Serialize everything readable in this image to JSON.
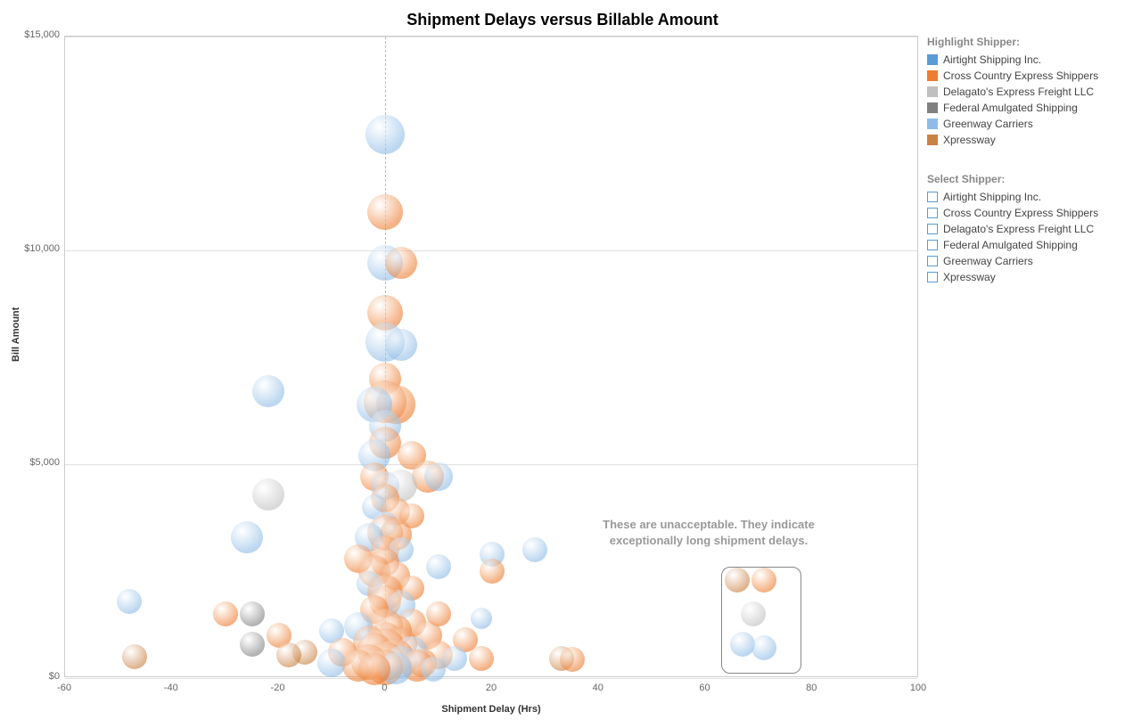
{
  "title": "Shipment Delays versus Billable Amount",
  "xlabel": "Shipment Delay (Hrs)",
  "ylabel": "Bill Amount",
  "xlim": [
    -60,
    100
  ],
  "ylim": [
    0,
    15000
  ],
  "x_ticks": [
    -60,
    -40,
    -20,
    0,
    20,
    40,
    60,
    80,
    100
  ],
  "y_ticks": [
    {
      "v": 0,
      "label": "$0"
    },
    {
      "v": 5000,
      "label": "$5,000"
    },
    {
      "v": 10000,
      "label": "$10,000"
    },
    {
      "v": 15000,
      "label": "$15,000"
    }
  ],
  "annotation": "These are unacceptable.  They indicate\nexceptionally long shipment delays.",
  "highlight_box": {
    "x0": 63,
    "x1": 78,
    "y0": 100,
    "y1": 2600
  },
  "legend_highlight_title": "Highlight Shipper:",
  "legend_select_title": "Select Shipper:",
  "shippers": [
    {
      "name": "Airtight Shipping Inc.",
      "color": "#5b9bd5"
    },
    {
      "name": "Cross Country Express Shippers",
      "color": "#ed7d31"
    },
    {
      "name": "Delagato's Express Freight LLC",
      "color": "#c0c0c0"
    },
    {
      "name": "Federal Amulgated Shipping",
      "color": "#808080"
    },
    {
      "name": "Greenway Carriers",
      "color": "#8fbce6"
    },
    {
      "name": "Xpressway",
      "color": "#c98244"
    }
  ],
  "chart_data": {
    "type": "scatter",
    "title": "Shipment Delays versus Billable Amount",
    "xlabel": "Shipment Delay (Hrs)",
    "ylabel": "Bill Amount",
    "xlim": [
      -60,
      100
    ],
    "ylim": [
      0,
      15000
    ],
    "reference_line_x": 0,
    "annotation": "These are unacceptable.  They indicate exceptionally long shipment delays.",
    "highlight_box": {
      "x_range": [
        63,
        78
      ],
      "y_range": [
        100,
        2600
      ]
    },
    "series": [
      {
        "name": "Airtight Shipping Inc.",
        "color": "#5b9bd5"
      },
      {
        "name": "Cross Country Express Shippers",
        "color": "#ed7d31"
      },
      {
        "name": "Delagato's Express Freight LLC",
        "color": "#c0c0c0"
      },
      {
        "name": "Federal Amulgated Shipping",
        "color": "#808080"
      },
      {
        "name": "Greenway Carriers",
        "color": "#8fbce6"
      },
      {
        "name": "Xpressway",
        "color": "#c98244"
      }
    ],
    "points": [
      {
        "x": 0,
        "y": 12700,
        "r": 22,
        "s": 4
      },
      {
        "x": 0,
        "y": 10900,
        "r": 20,
        "s": 1
      },
      {
        "x": 0,
        "y": 9700,
        "r": 20,
        "s": 4
      },
      {
        "x": 3,
        "y": 9700,
        "r": 18,
        "s": 1
      },
      {
        "x": 0,
        "y": 8550,
        "r": 20,
        "s": 1
      },
      {
        "x": 0,
        "y": 7850,
        "r": 22,
        "s": 4
      },
      {
        "x": 3,
        "y": 7800,
        "r": 18,
        "s": 4
      },
      {
        "x": 0,
        "y": 7000,
        "r": 18,
        "s": 1
      },
      {
        "x": -22,
        "y": 6700,
        "r": 18,
        "s": 4
      },
      {
        "x": 0,
        "y": 6450,
        "r": 24,
        "s": 1
      },
      {
        "x": 2,
        "y": 6400,
        "r": 22,
        "s": 1
      },
      {
        "x": -2,
        "y": 6400,
        "r": 20,
        "s": 4
      },
      {
        "x": 0,
        "y": 5900,
        "r": 18,
        "s": 4
      },
      {
        "x": 0,
        "y": 5500,
        "r": 18,
        "s": 1
      },
      {
        "x": -2,
        "y": 5200,
        "r": 18,
        "s": 4
      },
      {
        "x": 5,
        "y": 5200,
        "r": 16,
        "s": 1
      },
      {
        "x": 8,
        "y": 4700,
        "r": 18,
        "s": 1
      },
      {
        "x": 10,
        "y": 4700,
        "r": 16,
        "s": 4
      },
      {
        "x": -2,
        "y": 4700,
        "r": 16,
        "s": 1
      },
      {
        "x": 0,
        "y": 4500,
        "r": 16,
        "s": 4
      },
      {
        "x": 3,
        "y": 4500,
        "r": 18,
        "s": 2
      },
      {
        "x": -22,
        "y": 4300,
        "r": 18,
        "s": 2
      },
      {
        "x": 0,
        "y": 4200,
        "r": 16,
        "s": 1
      },
      {
        "x": -2,
        "y": 4000,
        "r": 14,
        "s": 4
      },
      {
        "x": 2,
        "y": 3900,
        "r": 16,
        "s": 1
      },
      {
        "x": 5,
        "y": 3800,
        "r": 14,
        "s": 1
      },
      {
        "x": 0,
        "y": 3600,
        "r": 14,
        "s": 4
      },
      {
        "x": 0,
        "y": 3400,
        "r": 20,
        "s": 1
      },
      {
        "x": 2,
        "y": 3350,
        "r": 18,
        "s": 1
      },
      {
        "x": -3,
        "y": 3300,
        "r": 16,
        "s": 4
      },
      {
        "x": -26,
        "y": 3300,
        "r": 18,
        "s": 4
      },
      {
        "x": 0,
        "y": 3000,
        "r": 16,
        "s": 1
      },
      {
        "x": 3,
        "y": 3000,
        "r": 14,
        "s": 4
      },
      {
        "x": 28,
        "y": 3000,
        "r": 14,
        "s": 4
      },
      {
        "x": 20,
        "y": 2900,
        "r": 14,
        "s": 4
      },
      {
        "x": -5,
        "y": 2800,
        "r": 16,
        "s": 1
      },
      {
        "x": 0,
        "y": 2700,
        "r": 16,
        "s": 1
      },
      {
        "x": 10,
        "y": 2600,
        "r": 14,
        "s": 4
      },
      {
        "x": 20,
        "y": 2500,
        "r": 14,
        "s": 1
      },
      {
        "x": -2,
        "y": 2500,
        "r": 18,
        "s": 1
      },
      {
        "x": 2,
        "y": 2400,
        "r": 16,
        "s": 1
      },
      {
        "x": 66,
        "y": 2300,
        "r": 14,
        "s": 5
      },
      {
        "x": 71,
        "y": 2300,
        "r": 14,
        "s": 1
      },
      {
        "x": -3,
        "y": 2200,
        "r": 14,
        "s": 4
      },
      {
        "x": 5,
        "y": 2100,
        "r": 14,
        "s": 1
      },
      {
        "x": 0,
        "y": 2000,
        "r": 20,
        "s": 1
      },
      {
        "x": -48,
        "y": 1800,
        "r": 14,
        "s": 4
      },
      {
        "x": 0,
        "y": 1800,
        "r": 18,
        "s": 1
      },
      {
        "x": 3,
        "y": 1700,
        "r": 16,
        "s": 4
      },
      {
        "x": -2,
        "y": 1600,
        "r": 16,
        "s": 1
      },
      {
        "x": -30,
        "y": 1500,
        "r": 14,
        "s": 1
      },
      {
        "x": -25,
        "y": 1500,
        "r": 14,
        "s": 3
      },
      {
        "x": 10,
        "y": 1500,
        "r": 14,
        "s": 1
      },
      {
        "x": 69,
        "y": 1500,
        "r": 14,
        "s": 2
      },
      {
        "x": 18,
        "y": 1400,
        "r": 12,
        "s": 4
      },
      {
        "x": 5,
        "y": 1300,
        "r": 16,
        "s": 1
      },
      {
        "x": 0,
        "y": 1200,
        "r": 20,
        "s": 1
      },
      {
        "x": -5,
        "y": 1200,
        "r": 16,
        "s": 4
      },
      {
        "x": 2,
        "y": 1100,
        "r": 18,
        "s": 1
      },
      {
        "x": -10,
        "y": 1100,
        "r": 14,
        "s": 4
      },
      {
        "x": -20,
        "y": 1000,
        "r": 14,
        "s": 1
      },
      {
        "x": 8,
        "y": 1000,
        "r": 16,
        "s": 1
      },
      {
        "x": 15,
        "y": 900,
        "r": 14,
        "s": 1
      },
      {
        "x": 0,
        "y": 900,
        "r": 20,
        "s": 1
      },
      {
        "x": -3,
        "y": 850,
        "r": 18,
        "s": 1
      },
      {
        "x": 3,
        "y": 800,
        "r": 18,
        "s": 1
      },
      {
        "x": -25,
        "y": 800,
        "r": 14,
        "s": 3
      },
      {
        "x": 67,
        "y": 800,
        "r": 14,
        "s": 4
      },
      {
        "x": 71,
        "y": 700,
        "r": 14,
        "s": 4
      },
      {
        "x": 0,
        "y": 700,
        "r": 22,
        "s": 1
      },
      {
        "x": -2,
        "y": 650,
        "r": 20,
        "s": 1
      },
      {
        "x": 5,
        "y": 600,
        "r": 18,
        "s": 4
      },
      {
        "x": -8,
        "y": 600,
        "r": 16,
        "s": 1
      },
      {
        "x": -15,
        "y": 600,
        "r": 14,
        "s": 5
      },
      {
        "x": -18,
        "y": 550,
        "r": 14,
        "s": 5
      },
      {
        "x": 10,
        "y": 550,
        "r": 16,
        "s": 1
      },
      {
        "x": 2,
        "y": 500,
        "r": 20,
        "s": 1
      },
      {
        "x": -47,
        "y": 500,
        "r": 14,
        "s": 5
      },
      {
        "x": 13,
        "y": 450,
        "r": 14,
        "s": 4
      },
      {
        "x": 18,
        "y": 450,
        "r": 14,
        "s": 1
      },
      {
        "x": 33,
        "y": 450,
        "r": 14,
        "s": 5
      },
      {
        "x": 35,
        "y": 430,
        "r": 14,
        "s": 1
      },
      {
        "x": 0,
        "y": 400,
        "r": 22,
        "s": 1
      },
      {
        "x": -3,
        "y": 380,
        "r": 20,
        "s": 1
      },
      {
        "x": 3,
        "y": 370,
        "r": 18,
        "s": 4
      },
      {
        "x": 7,
        "y": 350,
        "r": 16,
        "s": 1
      },
      {
        "x": -10,
        "y": 350,
        "r": 16,
        "s": 4
      },
      {
        "x": 6,
        "y": 300,
        "r": 18,
        "s": 1
      },
      {
        "x": -5,
        "y": 300,
        "r": 18,
        "s": 1
      },
      {
        "x": 0,
        "y": 250,
        "r": 20,
        "s": 1
      },
      {
        "x": 2,
        "y": 220,
        "r": 18,
        "s": 4
      },
      {
        "x": -2,
        "y": 200,
        "r": 18,
        "s": 1
      },
      {
        "x": 9,
        "y": 200,
        "r": 14,
        "s": 4
      }
    ]
  }
}
